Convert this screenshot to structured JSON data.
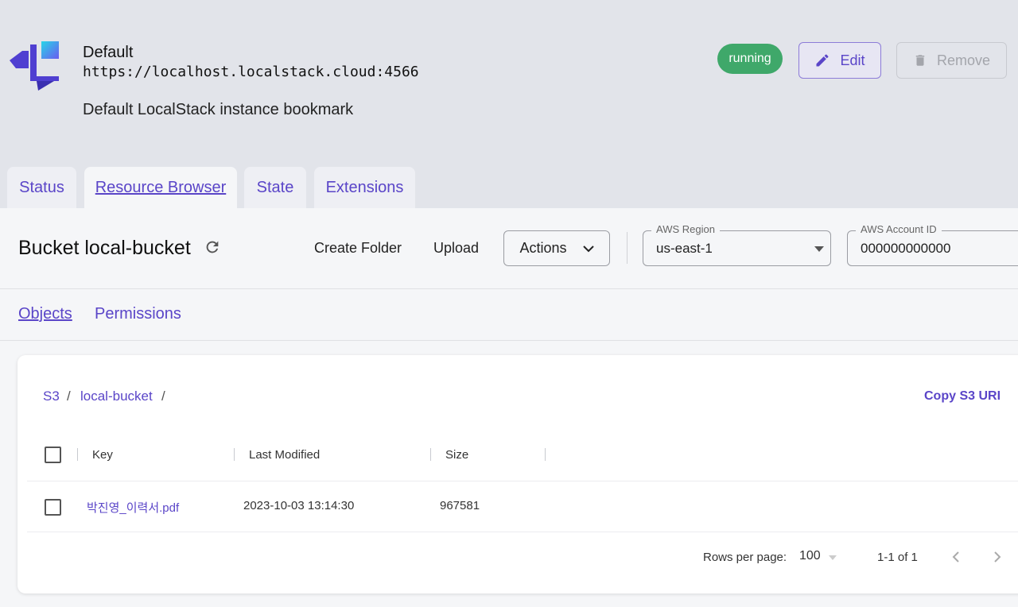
{
  "instance": {
    "name": "Default",
    "url": "https://localhost.localstack.cloud:4566",
    "description": "Default LocalStack instance bookmark",
    "status": "running",
    "edit_label": "Edit",
    "remove_label": "Remove"
  },
  "tabs": [
    {
      "label": "Status",
      "active": false
    },
    {
      "label": "Resource Browser",
      "active": true
    },
    {
      "label": "State",
      "active": false
    },
    {
      "label": "Extensions",
      "active": false
    }
  ],
  "toolbar": {
    "bucket_title": "Bucket local-bucket",
    "create_folder": "Create Folder",
    "upload": "Upload",
    "actions": "Actions",
    "region_label": "AWS Region",
    "region_value": "us-east-1",
    "account_label": "AWS Account ID",
    "account_value": "000000000000"
  },
  "subtabs": [
    {
      "label": "Objects",
      "active": true
    },
    {
      "label": "Permissions",
      "active": false
    }
  ],
  "breadcrumb": {
    "root": "S3",
    "bucket": "local-bucket",
    "separator": "/"
  },
  "copy_uri": "Copy S3 URI",
  "table": {
    "columns": [
      "Key",
      "Last Modified",
      "Size"
    ],
    "rows": [
      {
        "key": "박진영_이력서.pdf",
        "last_modified": "2023-10-03 13:14:30",
        "size": "967581"
      }
    ]
  },
  "pagination": {
    "rows_per_page_label": "Rows per page:",
    "rows_per_page": "100",
    "range": "1-1 of 1"
  },
  "colors": {
    "accent": "#5a45c8",
    "status_running": "#3fa86a",
    "header_bg": "#e2e4ea"
  },
  "icons": [
    "localstack-logo-icon",
    "pencil-icon",
    "trash-icon",
    "refresh-icon",
    "chevron-down-icon",
    "dropdown-arrow-icon",
    "chevron-left-icon",
    "chevron-right-icon"
  ]
}
